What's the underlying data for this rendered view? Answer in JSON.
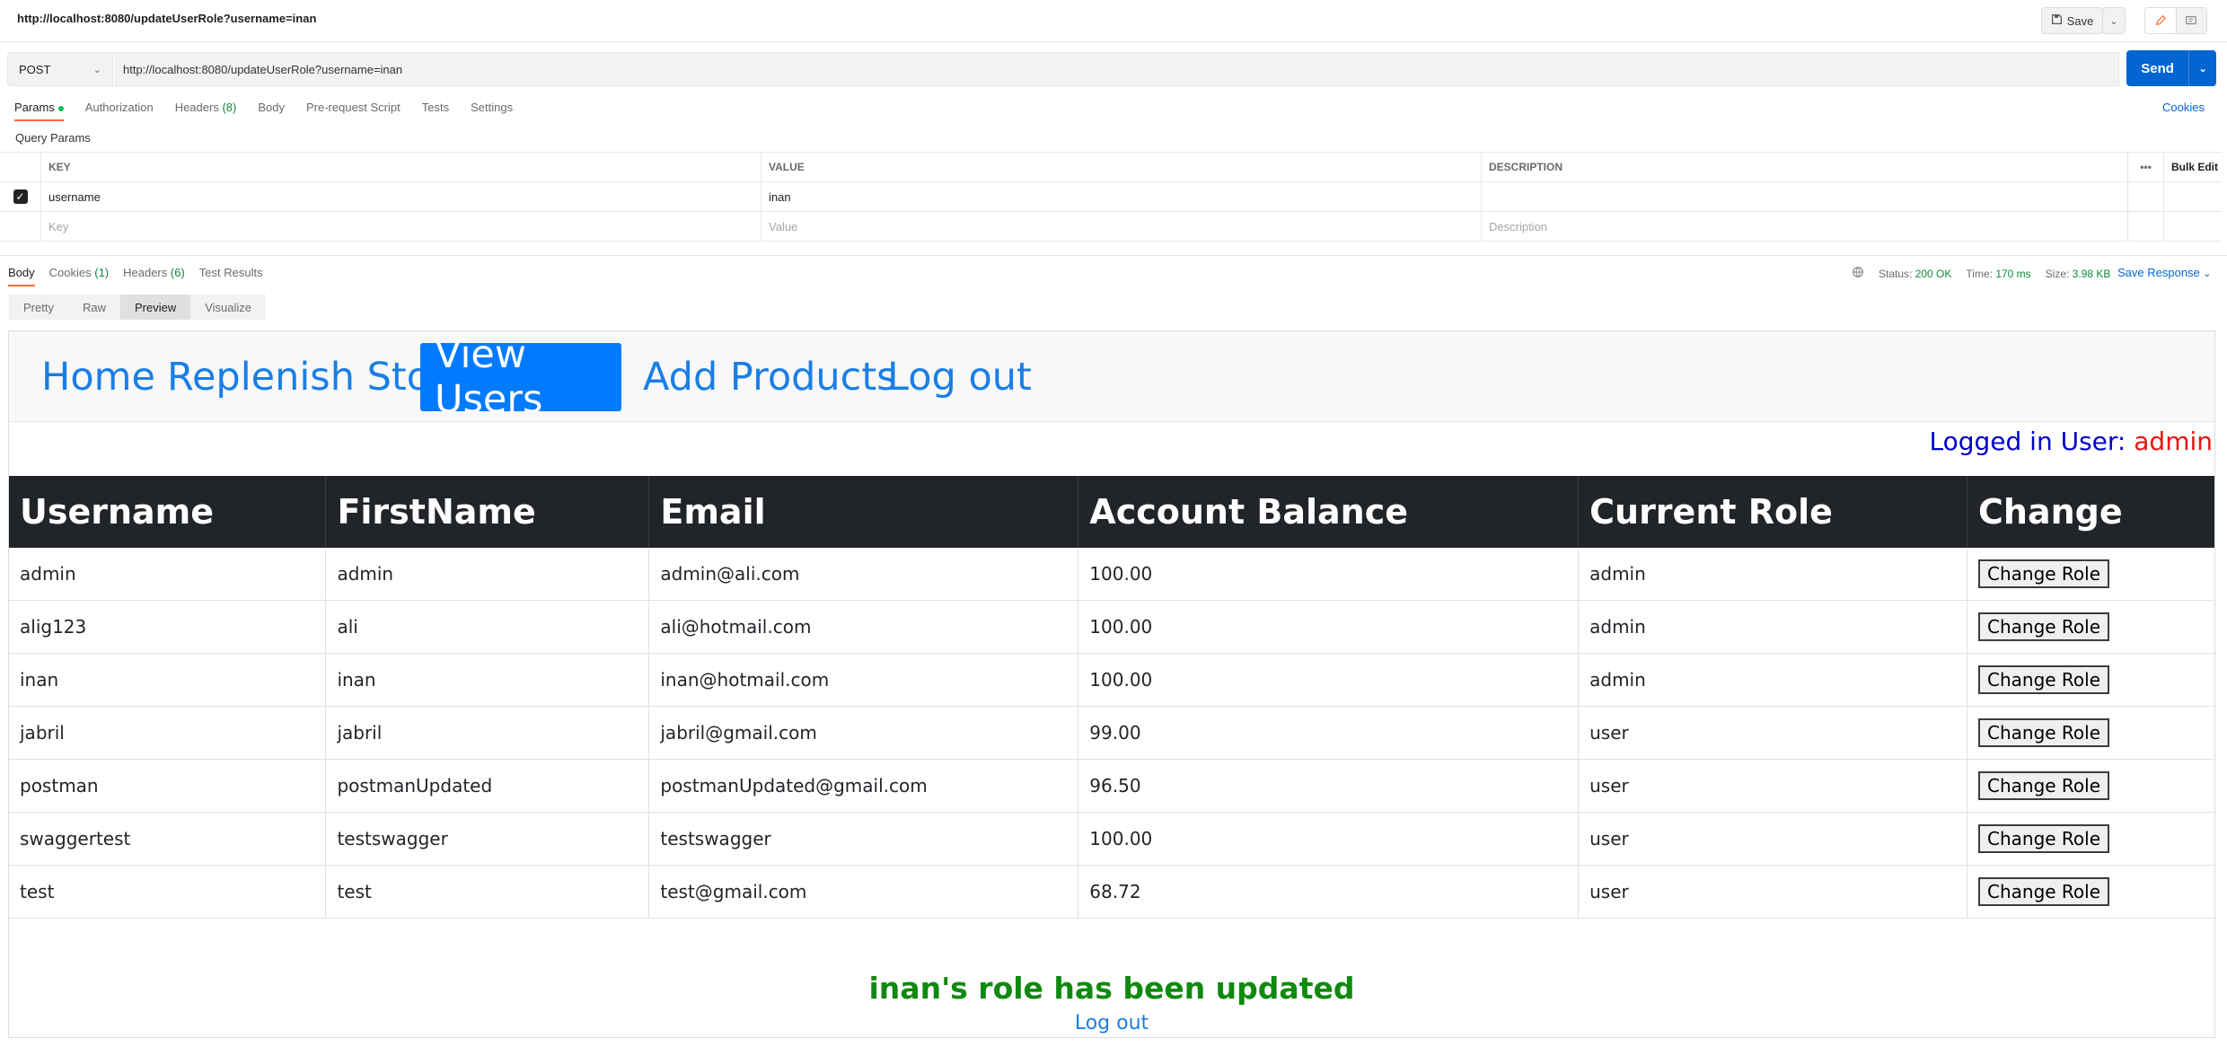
{
  "window": {
    "title": "http://localhost:8080/updateUserRole?username=inan",
    "save_label": "Save"
  },
  "request": {
    "method": "POST",
    "url": "http://localhost:8080/updateUserRole?username=inan",
    "send_label": "Send"
  },
  "request_tabs": [
    {
      "label": "Params"
    },
    {
      "label": "Authorization"
    },
    {
      "label": "Headers",
      "count": "(8)"
    },
    {
      "label": "Body"
    },
    {
      "label": "Pre-request Script"
    },
    {
      "label": "Tests"
    },
    {
      "label": "Settings"
    }
  ],
  "cookies_label": "Cookies",
  "query_params": {
    "title": "Query Params",
    "headers": {
      "key": "KEY",
      "value": "VALUE",
      "description": "DESCRIPTION",
      "bulk": "Bulk Edit"
    },
    "rows": [
      {
        "key": "username",
        "value": "inan",
        "description": ""
      }
    ],
    "placeholders": {
      "key": "Key",
      "value": "Value",
      "description": "Description"
    }
  },
  "response_tabs": [
    {
      "label": "Body"
    },
    {
      "label": "Cookies",
      "count": "(1)"
    },
    {
      "label": "Headers",
      "count": "(6)"
    },
    {
      "label": "Test Results"
    }
  ],
  "response_status": {
    "status_label": "Status:",
    "status": "200 OK",
    "time_label": "Time:",
    "time": "170 ms",
    "size_label": "Size:",
    "size": "3.98 KB",
    "save_response": "Save Response"
  },
  "view_modes": [
    "Pretty",
    "Raw",
    "Preview",
    "Visualize"
  ],
  "preview": {
    "nav": [
      "Home",
      "Replenish Stock",
      "View Users",
      "Add Products",
      "Log out"
    ],
    "logged_in_label": "Logged in User: ",
    "logged_in_user": "admin",
    "table_headers": [
      "Username",
      "FirstName",
      "Email",
      "Account Balance",
      "Current Role",
      "Change"
    ],
    "users": [
      {
        "username": "admin",
        "firstname": "admin",
        "email": "admin@ali.com",
        "balance": "100.00",
        "role": "admin"
      },
      {
        "username": "alig123",
        "firstname": "ali",
        "email": "ali@hotmail.com",
        "balance": "100.00",
        "role": "admin"
      },
      {
        "username": "inan",
        "firstname": "inan",
        "email": "inan@hotmail.com",
        "balance": "100.00",
        "role": "admin"
      },
      {
        "username": "jabril",
        "firstname": "jabril",
        "email": "jabril@gmail.com",
        "balance": "99.00",
        "role": "user"
      },
      {
        "username": "postman",
        "firstname": "postmanUpdated",
        "email": "postmanUpdated@gmail.com",
        "balance": "96.50",
        "role": "user"
      },
      {
        "username": "swaggertest",
        "firstname": "testswagger",
        "email": "testswagger",
        "balance": "100.00",
        "role": "user"
      },
      {
        "username": "test",
        "firstname": "test",
        "email": "test@gmail.com",
        "balance": "68.72",
        "role": "user"
      }
    ],
    "change_button_label": "Change Role",
    "message": "inan's role has been updated",
    "logout_link": "Log out"
  }
}
